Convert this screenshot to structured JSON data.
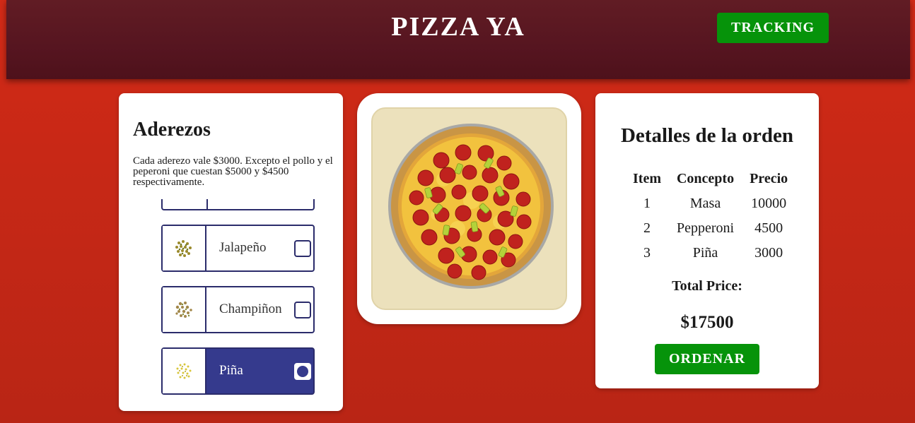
{
  "header": {
    "title": "PIZZA YA",
    "tracking_label": "TRACKING"
  },
  "toppings": {
    "heading": "Aderezos",
    "description": "Cada aderezo vale $3000. Excepto el pollo y el peperoni que cuestan $5000 y $4500 respectivamente.",
    "items": [
      {
        "label": "Jalapeño",
        "icon": "jalapeno-icon",
        "selected": false
      },
      {
        "label": "Champiñon",
        "icon": "mushroom-icon",
        "selected": false
      },
      {
        "label": "Piña",
        "icon": "pineapple-icon",
        "selected": true
      }
    ]
  },
  "order": {
    "heading": "Detalles de la orden",
    "columns": [
      "Item",
      "Concepto",
      "Precio"
    ],
    "rows": [
      [
        "1",
        "Masa",
        "10000"
      ],
      [
        "2",
        "Pepperoni",
        "4500"
      ],
      [
        "3",
        "Piña",
        "3000"
      ]
    ],
    "total_label": "Total Price:",
    "total_value": "$17500",
    "order_label": "ORDENAR"
  },
  "colors": {
    "background": "#c72816",
    "header": "#561520",
    "accent_green": "#06930a",
    "option_border": "#2b2c6b",
    "option_selected": "#353a8d"
  }
}
